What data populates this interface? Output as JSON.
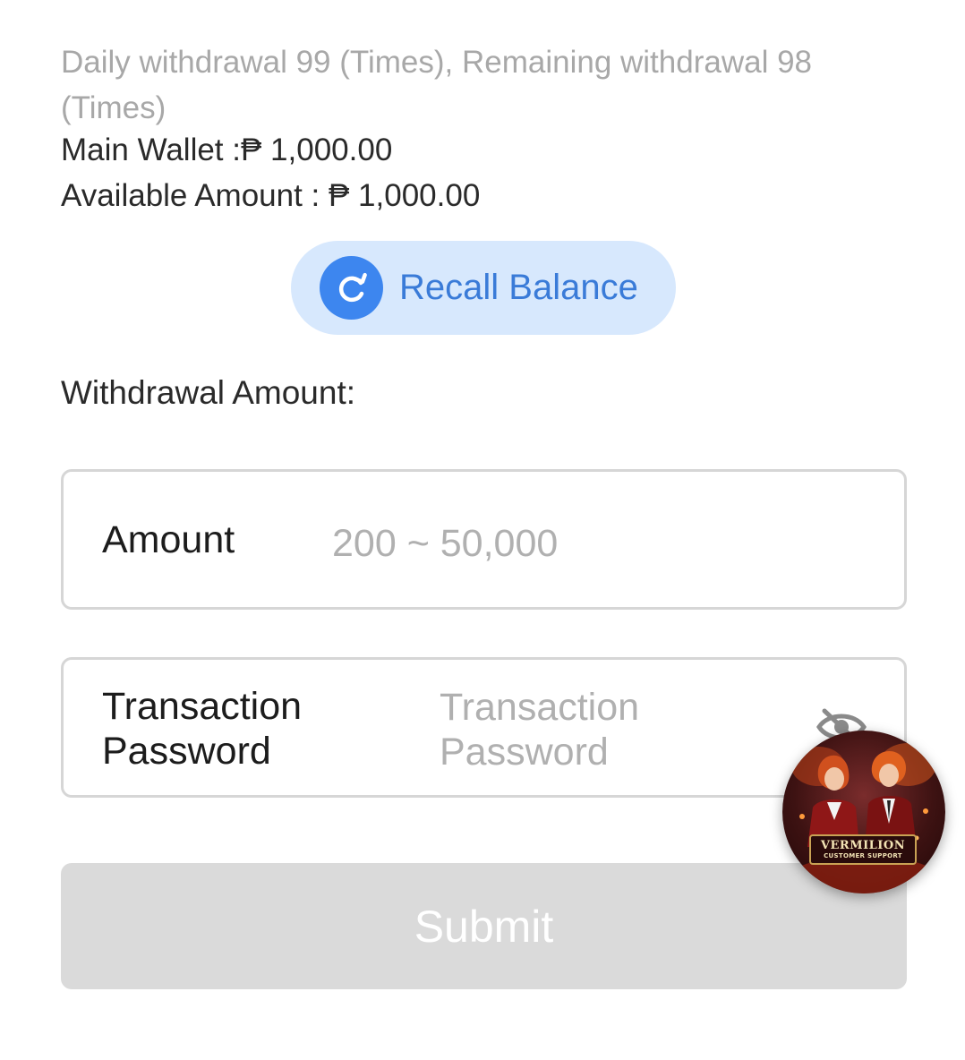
{
  "limits": {
    "text": "Daily withdrawal 99 (Times), Remaining withdrawal 98 (Times)"
  },
  "wallet": {
    "main_wallet": "Main Wallet :₱ 1,000.00",
    "available_amount": "Available Amount : ₱ 1,000.00"
  },
  "recall": {
    "label": "Recall Balance"
  },
  "withdrawal": {
    "section_label": "Withdrawal Amount:",
    "amount_label": "Amount",
    "amount_placeholder": "200 ~ 50,000",
    "password_label": "Transaction Password",
    "password_placeholder": "Transaction Password"
  },
  "submit": {
    "label": "Submit"
  },
  "support": {
    "title": "VERMILION",
    "subtitle": "CUSTOMER SUPPORT"
  },
  "icons": {
    "recall": "refresh-icon",
    "password_toggle": "eye-off-icon",
    "support": "customer-support-avatar"
  },
  "colors": {
    "accent": "#3d86ef",
    "accent_bg": "#d7e8fd",
    "submit_disabled": "#dadada",
    "border": "#d6d6d6"
  }
}
